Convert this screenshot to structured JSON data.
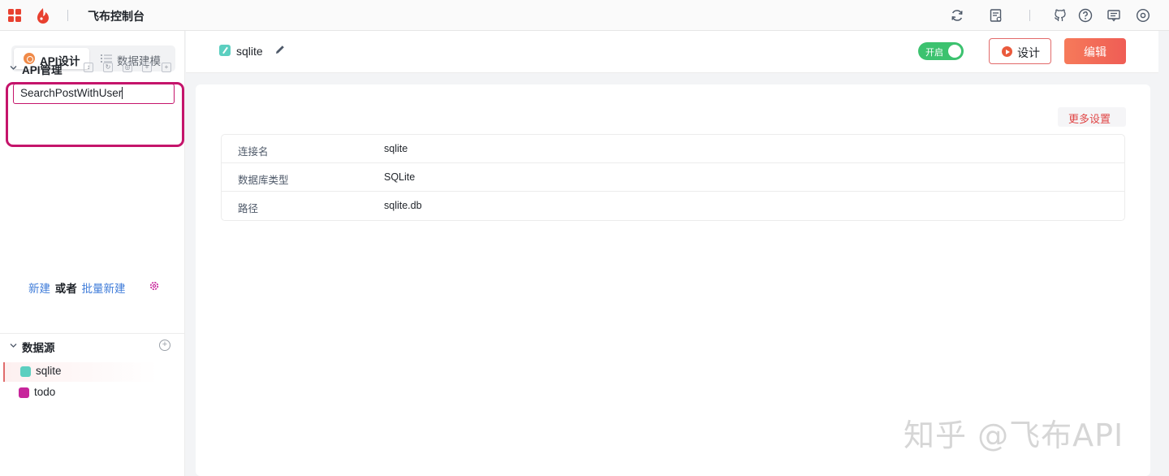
{
  "topbar": {
    "title": "飞布控制台",
    "icons": [
      "apps-grid-icon",
      "feibu-logo-icon",
      "refresh-icon",
      "document-icon",
      "github-icon",
      "help-icon",
      "message-icon",
      "settings-icon"
    ]
  },
  "sidebar": {
    "tabs": [
      {
        "label": "API设计",
        "active": true
      },
      {
        "label": "数据建模",
        "active": false
      }
    ],
    "api_section": {
      "title": "API管理",
      "input_value": "SearchPostWithUser"
    },
    "create": {
      "new_label": "新建",
      "or_label": "或者",
      "batch_label": "批量新建"
    },
    "datasource": {
      "title": "数据源",
      "items": [
        {
          "label": "sqlite",
          "active": true,
          "icon_color": "#5ccfc0"
        },
        {
          "label": "todo",
          "active": false,
          "icon_color": "#c7259b"
        }
      ]
    }
  },
  "main": {
    "title": "sqlite",
    "toggle_label": "开启",
    "design_button": "设计",
    "edit_button": "编辑",
    "more_settings": "更多设置",
    "details": [
      {
        "key": "连接名",
        "value": "sqlite"
      },
      {
        "key": "数据库类型",
        "value": "SQLite"
      },
      {
        "key": "路径",
        "value": "sqlite.db"
      }
    ]
  },
  "watermark": "知乎 @飞布API",
  "colors": {
    "accent_red": "#ef5d55",
    "toggle_green": "#3cc26f",
    "highlight_magenta": "#c5146b",
    "link_blue": "#3f7cd9"
  }
}
